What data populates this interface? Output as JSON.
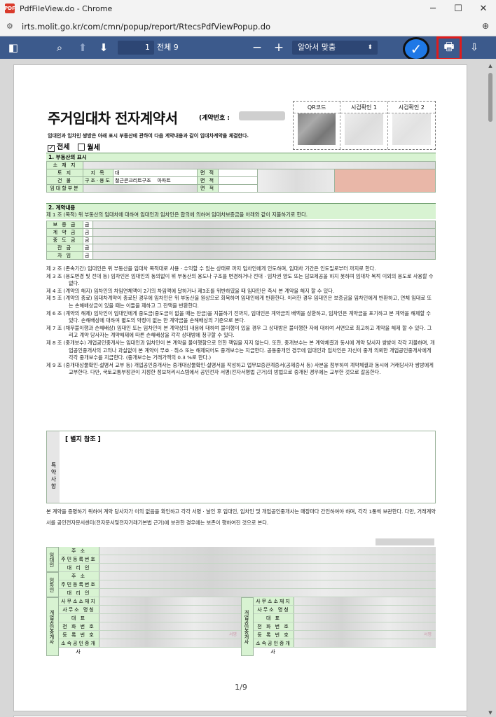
{
  "window": {
    "title": "PdfFileView.do - Chrome",
    "favicon": "PDF",
    "controls": {
      "minimize": "─",
      "maximize": "☐",
      "close": "✕"
    }
  },
  "address": {
    "url": "irts.molit.go.kr/com/cmn/popup/report/RtecsPdfViewPopup.do"
  },
  "toolbar": {
    "page_current": "1",
    "page_total": "전체 9",
    "zoom_label": "알아서 맞춤",
    "zoom_minus": "−",
    "zoom_plus": "+"
  },
  "document": {
    "title": "주거임대차 전자계약서",
    "contract_no_label": "(계약번호 :",
    "intro": "임대인과 임차인 쌍방은 아래 표시 부동산에 관하여 다음 계약내용과 같이 임대차계약을 체결한다.",
    "qr_labels": [
      "QR코드",
      "시검확인 1",
      "시검확인 2"
    ],
    "deposit_type": {
      "jeonse": "전세",
      "wolse": "월세",
      "jeonse_checked": true
    },
    "section1": "1. 부동산의 표시",
    "prop_rows": {
      "location": "소 재 지",
      "land": "토 지",
      "land_type": "지 목",
      "land_value": "대",
      "area": "면 적",
      "building": "건 물",
      "structure": "구조·용도",
      "structure_value": "철근콘크리트구조",
      "use_value": "아파트",
      "leased": "임대할부분"
    },
    "section2": "2. 계약내용",
    "article1": "제 1 조 (목적) 위 부동산의 임대차에 대하여 임대인과 임차인은 합의에 의하여 임대차보증금을 아래와 같이 지불하기로 한다.",
    "money_rows": [
      "보 증 금",
      "계 약 금",
      "중 도 금",
      "잔 금",
      "차 임"
    ],
    "money_unit": "금",
    "clauses": [
      "제 2 조 (존속기간) 임대인은 위 부동산을 임대차 목적대로 사용 · 수익할 수 있는 상태로 까지 임차인에게 인도하며, 임대차 기간은 인도일로부터 까지로 한다.",
      "제 3 조 (용도변경 및 전대 등) 임차인은 임대인의 동의없이 위 부동산의 용도나 구조를 변경하거나 전대 · 임차권 양도 또는 담보제공을 하지 못하며 임대차 목적 이외의 용도로 사용할 수 없다.",
      "제 4 조 (계약의 해지) 임차인의 차임연체액이 2기의 차임액에 달하거나 제3조를 위반하였을 때 임대인은 즉시 본 계약을 해지 할 수 있다.",
      "제 5 조 (계약의 종료) 임대차계약이 종료된 경우에 임차인은 위 부동산을 원상으로 회복하여 임대인에게 반환한다. 이러한 경우 임대인은 보증금을 임차인에게 반환하고, 연체 임대료 또는 손해배상금이 있을 때는 이들을 제하고 그 잔액을 반환한다.",
      "제 6 조 (계약의 해제) 임차인이 임대인에게 중도금(중도금이 없을 때는 잔금)을 지불하기 전까지, 임대인은 계약금의 배액을 상환하고, 임차인은 계약금을 포기하고 본 계약을 해제할 수 있다. 손해배상에 대하여 별도의 약정이 없는 한 계약금을 손해배상의 기준으로 본다.",
      "제 7 조 (채무불이행과 손해배상) 임대인 또는 임차인이 본 계약상의 내용에 대하여 불이행이 있을 경우 그 상대방은 불이행한 자에 대하여 서면으로 최고하고 계약을 해제 할 수 있다. 그리고 계약 당사자는 계약해제에 따른 손해배상을 각각 상대방에 청구할 수 있다.",
      "제 8 조 (중개보수) 개업공인중개사는 임대인과 임차인이 본 계약을 불이행함으로 인한 책임을 지지 않는다. 또한, 중개보수는 본 계약체결과 동시에 계약 당사자 쌍방이 각각 지불하며, 개업공인중개사의 고의나 과실없이 본 계약이 무효 · 취소 또는 해제되어도 중개보수는 지급한다. 공동중개인 경우에 임대인과 임차인은 자신이 중개 의뢰한 개업공인중개사에게 각각 중개보수를 지급한다. (중개보수는 거래가액의 0.3 %로 한다.)",
      "제 9 조 (중개대상물확인·설명서 교부 등) 개업공인중개사는 중개대상물확인·설명서를 작성하고 업무보증관계증서(공제증서 등) 사본을 첨부하여 계약체결과 동시에 거래당사자 쌍방에게 교부한다. 다만, 국토교통부장관이 지정한 정보처리시스템에서 공인전자 서명(전자서명법 근거)의 방법으로 중개된 경우에는 교부한 것으로 갈음한다."
    ],
    "special_side": "특약사항",
    "special_label": "[ 별지 참조 ]",
    "closing": "본 계약을 증명하기 위하여 계약 당사자가 이의 없음을 확인하고 각각 서명 · 날인 후 임대인, 임차인 및 개업공인중개사는 매장마다 간인하여야 하며, 각각 1통씩 보관한다. 다만, 거래계약서를 공인전자문서센터(전자문서및전자거래기본법 근거)에 보관한 경우에는 보존이 행하여진 것으로 본다.",
    "signers": {
      "landlord": "임대인",
      "tenant": "임차인",
      "agent": "개업공인중개사",
      "person_rows": [
        "주 소",
        "주민등록번호",
        "대 리 인"
      ],
      "agent_rows": [
        "사무소소재지",
        "사무소 명칭",
        "대 표",
        "전 화 번 호",
        "등 록 번 호",
        "소속공인중개사"
      ],
      "seal_label": "서명"
    },
    "page_indicator": "1/9"
  }
}
